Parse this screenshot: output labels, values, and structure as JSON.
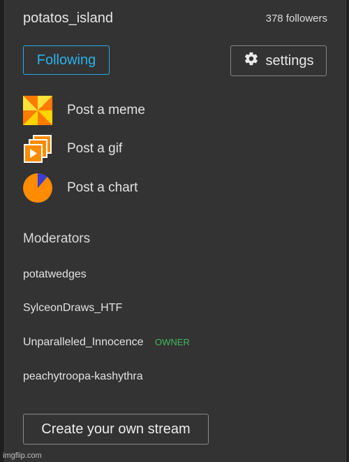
{
  "stream": {
    "name": "potatos_island",
    "followers": "378 followers"
  },
  "actions": {
    "follow_label": "Following",
    "settings_label": "settings"
  },
  "posts": [
    {
      "label": "Post a meme",
      "icon": "pinwheel-meme-icon"
    },
    {
      "label": "Post a gif",
      "icon": "stacked-frames-gif-icon"
    },
    {
      "label": "Post a chart",
      "icon": "pie-chart-icon"
    }
  ],
  "moderators": {
    "heading": "Moderators",
    "list": [
      {
        "name": "potatwedges",
        "badge": ""
      },
      {
        "name": "SylceonDraws_HTF",
        "badge": ""
      },
      {
        "name": "Unparalleled_Innocence",
        "badge": "OWNER"
      },
      {
        "name": "peachytroopa-kashythra",
        "badge": ""
      }
    ]
  },
  "footer": {
    "create_label": "Create your own stream",
    "watermark": "imgflip.com"
  },
  "colors": {
    "panel": "#333333",
    "following_accent": "#2bb2ec",
    "owner_badge": "#3fba5e",
    "icon_orange": "#ff8c00",
    "icon_yellow": "#ffd400",
    "pie_blue": "#3b3bd6"
  }
}
